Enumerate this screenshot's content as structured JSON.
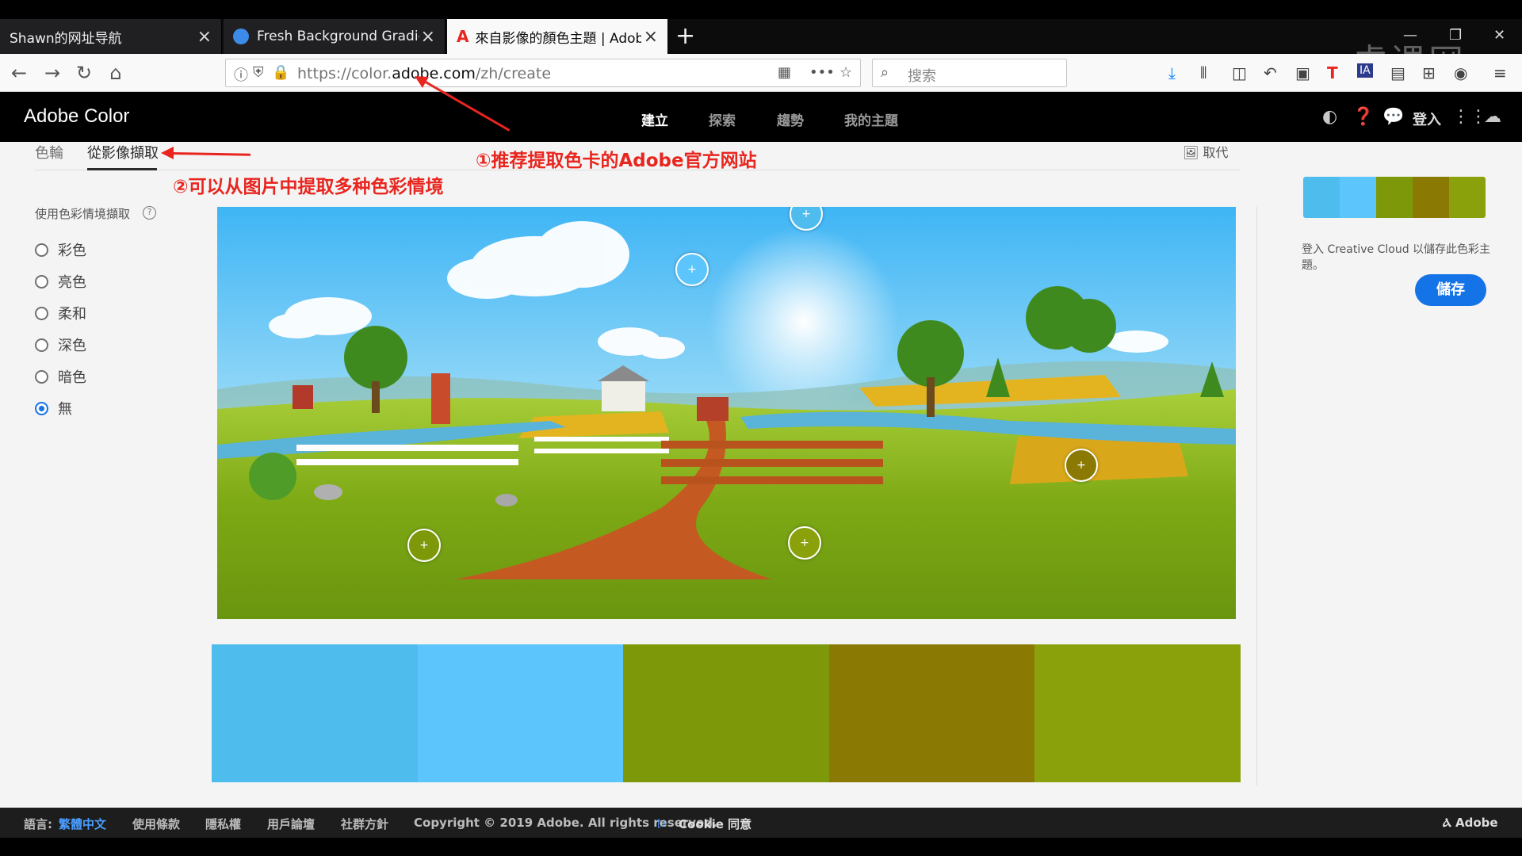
{
  "browser": {
    "tabs": [
      {
        "title": "Shawn的网址导航"
      },
      {
        "title": "Fresh Background Gradients"
      },
      {
        "title": "來自影像的顏色主題 | Adobe C"
      }
    ],
    "url_prefix": "https://color.",
    "url_domain": "adobe.com",
    "url_path": "/zh/create",
    "search_placeholder": "搜索",
    "watermark": "虎课网"
  },
  "app": {
    "logo": "Adobe Color",
    "nav": [
      "建立",
      "探索",
      "趨勢",
      "我的主題"
    ],
    "login": "登入"
  },
  "subtabs": {
    "wheel": "色輪",
    "image": "從影像擷取",
    "replace": "取代"
  },
  "mood": {
    "title": "使用色彩情境擷取",
    "options": [
      "彩色",
      "亮色",
      "柔和",
      "深色",
      "暗色",
      "無"
    ],
    "selected": "無"
  },
  "palette": {
    "colors": [
      "#4fbcee",
      "#5cc6fc",
      "#7d9909",
      "#8a7a04",
      "#8aa10c"
    ]
  },
  "save_panel": {
    "note": "登入 Creative Cloud 以儲存此色彩主題。",
    "save_label": "儲存"
  },
  "annotations": {
    "first": "①推荐提取色卡的Adobe官方网站",
    "second": "②可以从图片中提取多种色彩情境"
  },
  "footer": {
    "lang_label": "語言:",
    "lang_value": "繁體中文",
    "terms": "使用條款",
    "privacy": "隱私權",
    "forums": "用戶論壇",
    "community": "社群方針",
    "copyright": "Copyright © 2019 Adobe. All rights reserved.",
    "cookie": "Cookie 同意",
    "brand": "Adobe"
  }
}
